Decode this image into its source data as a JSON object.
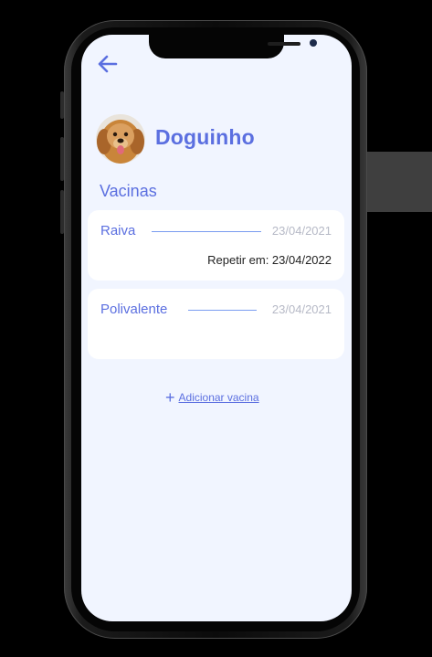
{
  "colors": {
    "accent": "#5b6fe0",
    "screen_bg": "#f1f5ff",
    "card_bg": "#ffffff",
    "date_text": "#b6b9c6"
  },
  "header": {
    "back_icon": "arrow-left-icon"
  },
  "pet": {
    "name": "Doguinho",
    "avatar_icon": "dog-photo"
  },
  "section": {
    "title": "Vacinas"
  },
  "vaccines": [
    {
      "name": "Raiva",
      "date": "23/04/2021",
      "repeat": "Repetir em: 23/04/2022"
    },
    {
      "name": "Polivalente",
      "date": "23/04/2021",
      "repeat": ""
    }
  ],
  "add_vaccine": {
    "icon": "plus-icon",
    "label": "Adicionar vacina"
  }
}
